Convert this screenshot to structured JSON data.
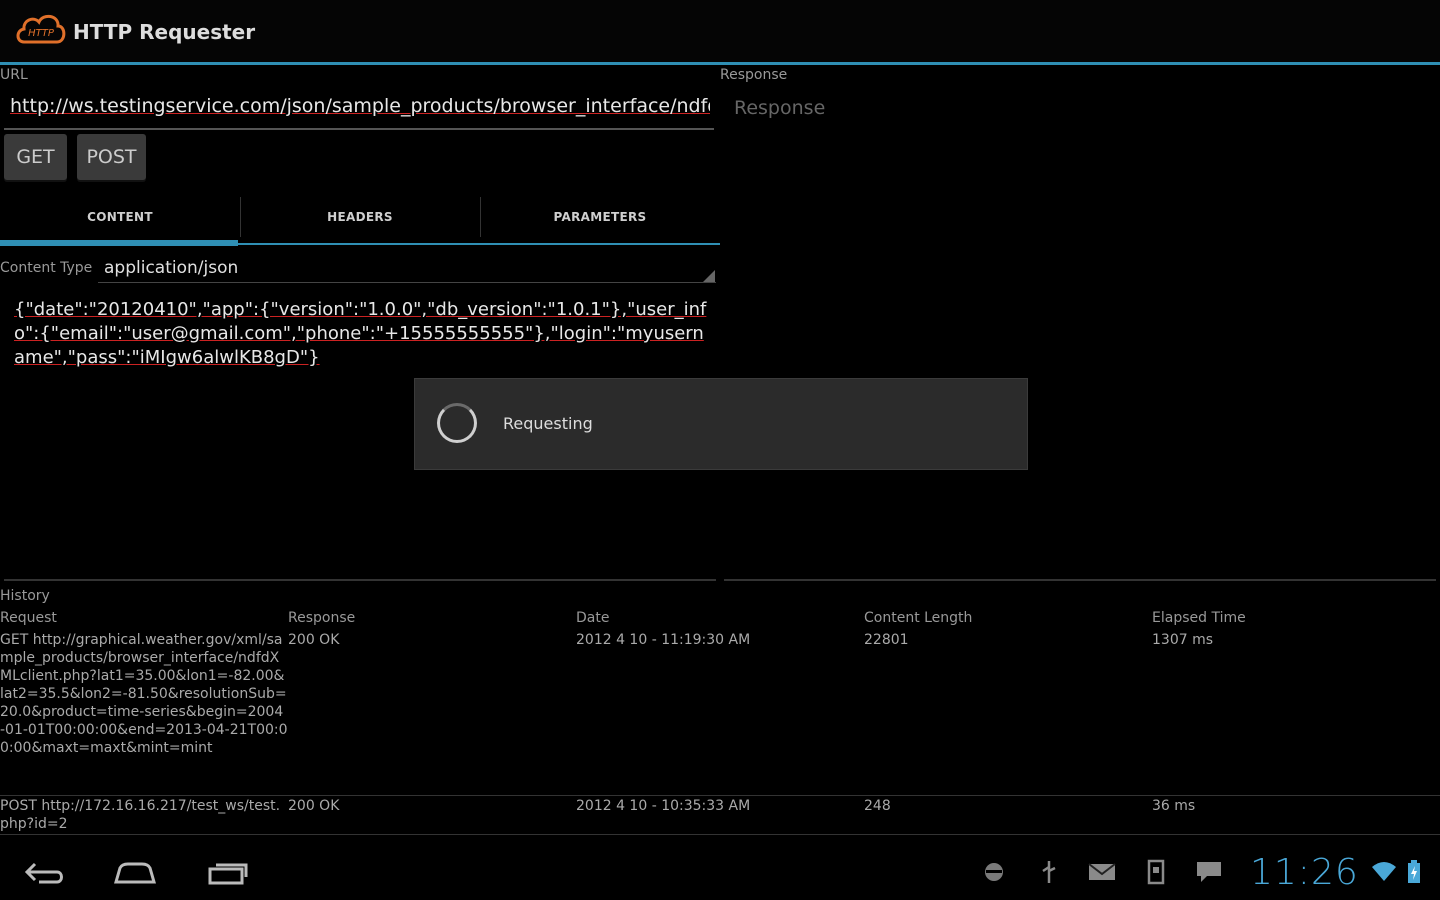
{
  "app": {
    "title": "HTTP Requester",
    "logo_text": "HTTP"
  },
  "url": {
    "label": "URL",
    "value": "http://ws.testingservice.com/json/sample_products/browser_interface/ndfdX"
  },
  "response": {
    "label": "Response",
    "placeholder": "Response"
  },
  "buttons": {
    "get": "GET",
    "post": "POST"
  },
  "tabs": [
    {
      "label": "CONTENT",
      "selected": true
    },
    {
      "label": "HEADERS",
      "selected": false
    },
    {
      "label": "PARAMETERS",
      "selected": false
    }
  ],
  "content": {
    "type_label": "Content Type",
    "type_value": "application/json",
    "body": "{\"date\":\"20120410\",\"app\":{\"version\":\"1.0.0\",\"db_version\":\"1.0.1\"},\"user_info\":{\"email\":\"user@gmail.com\",\"phone\":\"+15555555555\"},\"login\":\"myusername\",\"pass\":\"iMIgw6alwlKB8gD\"}"
  },
  "dialog": {
    "message": "Requesting"
  },
  "history": {
    "label": "History",
    "columns": [
      "Request",
      "Response",
      "Date",
      "Content Length",
      "Elapsed Time"
    ],
    "rows": [
      {
        "request": "GET http://graphical.weather.gov/xml/sample_products/browser_interface/ndfdXMLclient.php?lat1=35.00&lon1=-82.00&lat2=35.5&lon2=-81.50&resolutionSub=20.0&product=time-series&begin=2004-01-01T00:00:00&end=2013-04-21T00:00:00&maxt=maxt&mint=mint",
        "response": "200 OK",
        "date": "2012 4 10 - 11:19:30 AM",
        "length": "22801",
        "elapsed": "1307 ms"
      },
      {
        "request": "POST http://172.16.16.217/test_ws/test.php?id=2",
        "response": "200 OK",
        "date": "2012 4 10 - 10:35:33 AM",
        "length": "248",
        "elapsed": "36 ms"
      }
    ]
  },
  "statusbar": {
    "time": "11:26"
  },
  "colors": {
    "accent": "#2f8fb4",
    "clock": "#4aa8d8",
    "logo": "#e0702a"
  }
}
